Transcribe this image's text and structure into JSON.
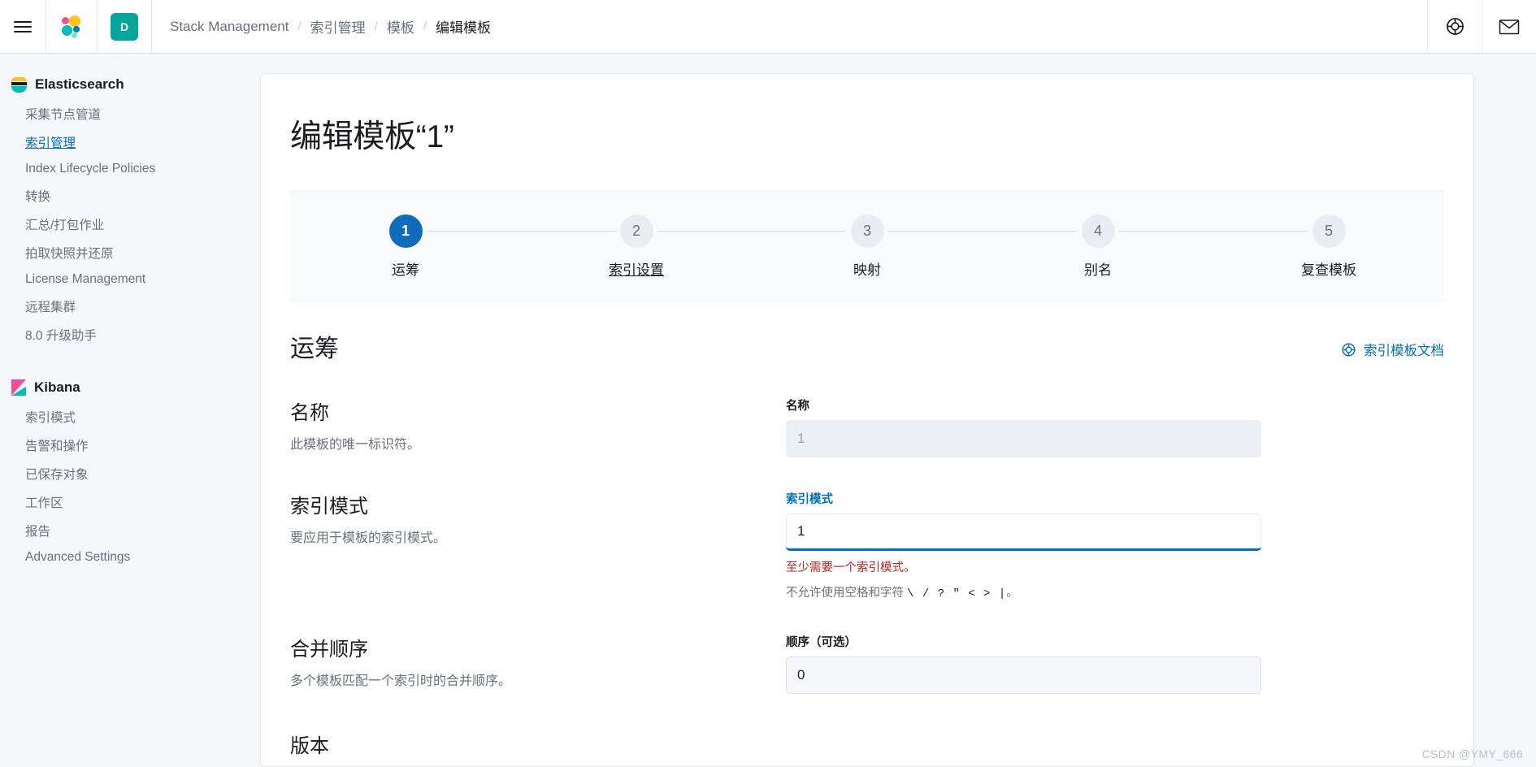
{
  "header": {
    "menu_icon": "hamburger-menu-icon",
    "logo_icon": "elastic-logo-icon",
    "space_badge": "D",
    "breadcrumbs": [
      {
        "label": "Stack Management",
        "active": false
      },
      {
        "label": "索引管理",
        "active": false
      },
      {
        "label": "模板",
        "active": false
      },
      {
        "label": "编辑模板",
        "active": true
      }
    ],
    "separator": "/",
    "right_icons": [
      {
        "name": "help-life-ring-icon"
      },
      {
        "name": "mail-envelope-icon"
      }
    ]
  },
  "sidebar": {
    "groups": [
      {
        "title": "Elasticsearch",
        "icon": "elasticsearch-logo-icon",
        "items": [
          {
            "label": "采集节点管道",
            "selected": false
          },
          {
            "label": "索引管理",
            "selected": true
          },
          {
            "label": "Index Lifecycle Policies",
            "selected": false
          },
          {
            "label": "转换",
            "selected": false
          },
          {
            "label": "汇总/打包作业",
            "selected": false
          },
          {
            "label": "拍取快照并还原",
            "selected": false
          },
          {
            "label": "License Management",
            "selected": false
          },
          {
            "label": "远程集群",
            "selected": false
          },
          {
            "label": "8.0 升级助手",
            "selected": false
          }
        ]
      },
      {
        "title": "Kibana",
        "icon": "kibana-logo-icon",
        "items": [
          {
            "label": "索引模式",
            "selected": false
          },
          {
            "label": "告警和操作",
            "selected": false
          },
          {
            "label": "已保存对象",
            "selected": false
          },
          {
            "label": "工作区",
            "selected": false
          },
          {
            "label": "报告",
            "selected": false
          },
          {
            "label": "Advanced Settings",
            "selected": false
          }
        ]
      }
    ]
  },
  "main": {
    "page_title": "编辑模板“1”",
    "stepper": [
      {
        "number": "1",
        "label": "运筹",
        "state": "current"
      },
      {
        "number": "2",
        "label": "索引设置",
        "state": "hovered"
      },
      {
        "number": "3",
        "label": "映射",
        "state": "upcoming"
      },
      {
        "number": "4",
        "label": "别名",
        "state": "upcoming"
      },
      {
        "number": "5",
        "label": "复查模板",
        "state": "upcoming"
      }
    ],
    "section": {
      "title": "运筹",
      "doc_link": "索引模板文档",
      "doc_link_icon": "help-life-ring-icon"
    },
    "fields": [
      {
        "heading": "名称",
        "description": "此模板的唯一标识符。",
        "label": "名称",
        "value": "1",
        "state": "disabled"
      },
      {
        "heading": "索引模式",
        "description": "要应用于模板的索引模式。",
        "label": "索引模式",
        "value": "1",
        "state": "focused-invalid",
        "error": "至少需要一个索引模式。",
        "help_prefix": "不允许使用空格和字符 ",
        "help_chars": "\\ / ? \" < > |",
        "help_suffix": "。"
      },
      {
        "heading": "合并顺序",
        "description": "多个模板匹配一个索引时的合并顺序。",
        "label": "顺序（可选）",
        "value": "0",
        "state": "normal"
      }
    ],
    "next_heading": "版本"
  },
  "watermark": "CSDN @YMY_666",
  "colors": {
    "accent": "#0071c2",
    "step_active": "#0f6cbd",
    "error": "#bd271e",
    "teal": "#00a69b",
    "chrome_bg": "#f5f7fa"
  }
}
